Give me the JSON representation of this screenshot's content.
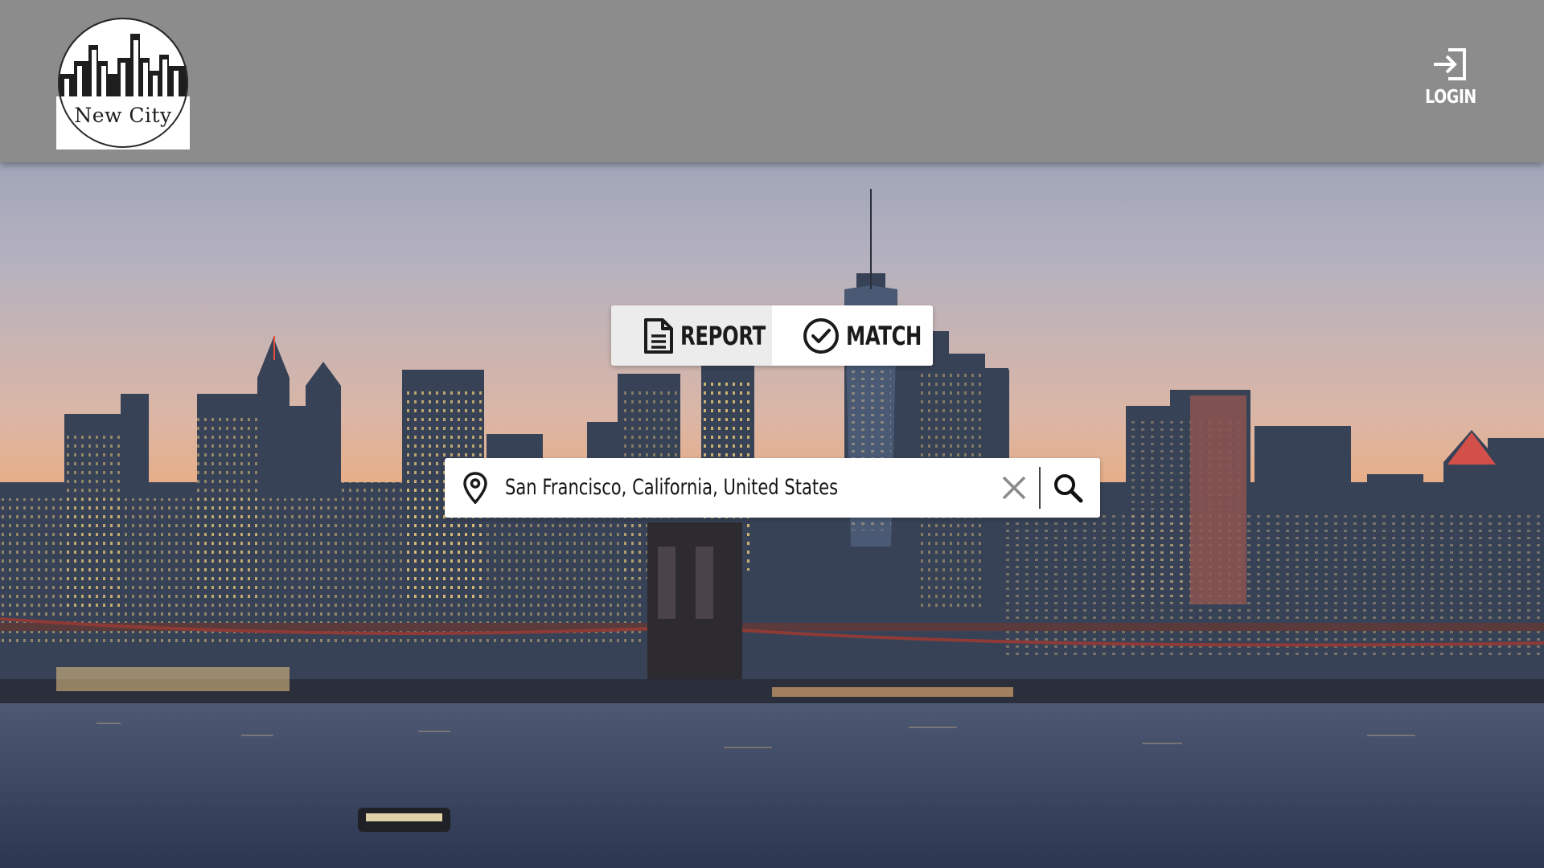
{
  "header": {
    "logo_text": "New City",
    "login_label": "LOGIN"
  },
  "mode_toggle": {
    "report_label": "REPORT",
    "match_label": "MATCH",
    "active": "report"
  },
  "search": {
    "value": "San Francisco, California, United States"
  },
  "icons": {
    "login": "login-arrow-icon",
    "report": "document-icon",
    "match": "check-circle-icon",
    "location": "map-pin-icon",
    "clear": "close-icon",
    "search": "search-icon"
  },
  "colors": {
    "header_bg": "#8c8c8d",
    "toggle_active_bg": "#ececec",
    "text_dark": "#1b1b1b",
    "white": "#ffffff"
  }
}
